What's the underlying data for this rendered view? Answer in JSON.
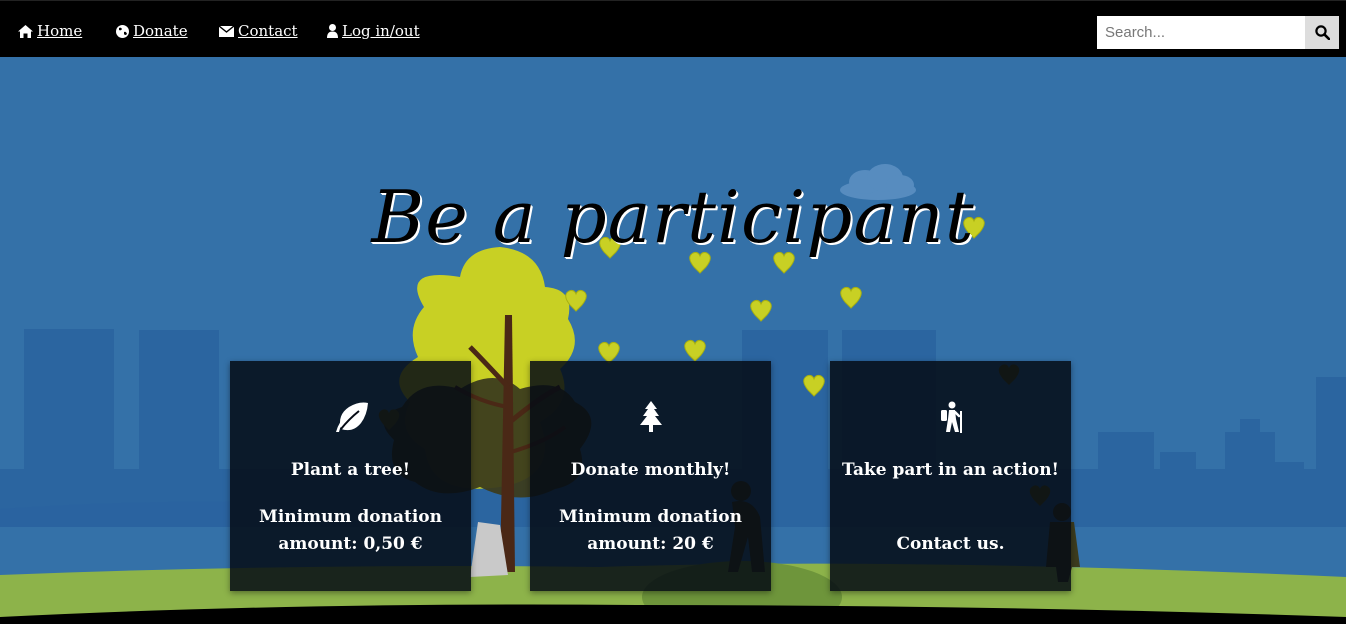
{
  "nav": {
    "items": [
      {
        "label": "Home",
        "icon": "home-icon"
      },
      {
        "label": "Donate",
        "icon": "globe-icon"
      },
      {
        "label": "Contact",
        "icon": "envelope-icon"
      },
      {
        "label": "Log in/out",
        "icon": "user-icon"
      }
    ],
    "search": {
      "placeholder": "Search...",
      "value": "",
      "icon": "search-icon"
    }
  },
  "hero": {
    "title": "Be a participant"
  },
  "cards": [
    {
      "icon": "leaf-icon",
      "title": "Plant a tree!",
      "text": "Minimum donation amount: 0,50 €"
    },
    {
      "icon": "tree-icon",
      "title": "Donate monthly!",
      "text": "Minimum donation amount: 20 €"
    },
    {
      "icon": "hiker-icon",
      "title": "Take part in an action!",
      "text": "Contact us."
    }
  ],
  "colors": {
    "navbar": "#000000",
    "sky": "#3471a8",
    "grass": "#8db34a",
    "tree_foliage": "#c8d024",
    "card_bg": "#050a14"
  }
}
